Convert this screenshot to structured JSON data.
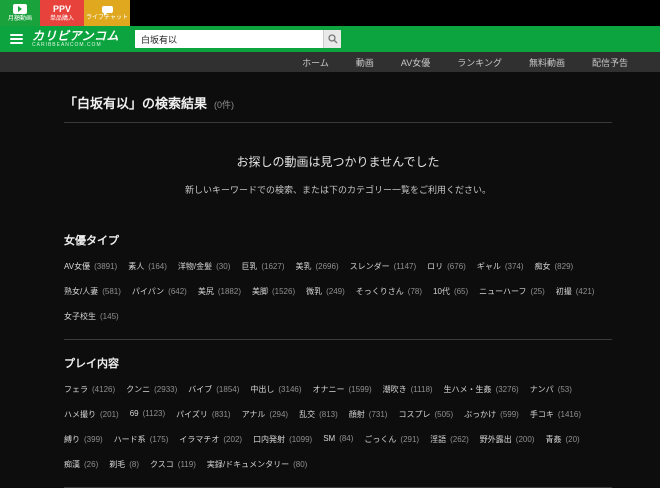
{
  "colors": {
    "brand_green": "#0ba43e",
    "monthly_green": "#1aa23c",
    "ppv_red": "#e8423c",
    "chat_yellow": "#dfa81e",
    "background": "#0d0d0d"
  },
  "promo_bar": {
    "monthly_button": {
      "label": "月額動画",
      "icon": "play-icon"
    },
    "ppv_button": {
      "title": "PPV",
      "label": "単品購入"
    },
    "chat_button": {
      "label": "ライブチャット",
      "icon": "chat-icon"
    }
  },
  "header": {
    "menu_icon": "hamburger-icon",
    "logo_title": "カリビアンコム",
    "logo_subtitle": "CARIBBEANCOM.COM",
    "search": {
      "value": "白坂有以",
      "icon": "search-icon"
    }
  },
  "nav": {
    "items": [
      "ホーム",
      "動画",
      "AV女優",
      "ランキング",
      "無料動画",
      "配信予告"
    ]
  },
  "main": {
    "title": "「白坂有以」の検索結果",
    "result_count": "(0件)",
    "empty_message": "お探しの動画は見つかりませんでした",
    "empty_hint": "新しいキーワードでの検索、または下のカテゴリー一覧をご利用ください。"
  },
  "categories": [
    {
      "heading": "女優タイプ",
      "tags": [
        {
          "label": "AV女優",
          "count": 3891
        },
        {
          "label": "素人",
          "count": 164
        },
        {
          "label": "洋物/金髪",
          "count": 30
        },
        {
          "label": "巨乳",
          "count": 1627
        },
        {
          "label": "美乳",
          "count": 2696
        },
        {
          "label": "スレンダー",
          "count": 1147
        },
        {
          "label": "ロリ",
          "count": 676
        },
        {
          "label": "ギャル",
          "count": 374
        },
        {
          "label": "痴女",
          "count": 829
        },
        {
          "label": "熟女/人妻",
          "count": 581
        },
        {
          "label": "パイパン",
          "count": 642
        },
        {
          "label": "美尻",
          "count": 1882
        },
        {
          "label": "美脚",
          "count": 1526
        },
        {
          "label": "微乳",
          "count": 249
        },
        {
          "label": "そっくりさん",
          "count": 78
        },
        {
          "label": "10代",
          "count": 65
        },
        {
          "label": "ニューハーフ",
          "count": 25
        },
        {
          "label": "初撮",
          "count": 421
        },
        {
          "label": "女子校生",
          "count": 145
        }
      ]
    },
    {
      "heading": "プレイ内容",
      "tags": [
        {
          "label": "フェラ",
          "count": 4126
        },
        {
          "label": "クンニ",
          "count": 2933
        },
        {
          "label": "バイブ",
          "count": 1854
        },
        {
          "label": "中出し",
          "count": 3146
        },
        {
          "label": "オナニー",
          "count": 1599
        },
        {
          "label": "潮吹き",
          "count": 1118
        },
        {
          "label": "生ハメ・生姦",
          "count": 3276
        },
        {
          "label": "ナンパ",
          "count": 53
        },
        {
          "label": "ハメ撮り",
          "count": 201
        },
        {
          "label": "69",
          "count": 1123
        },
        {
          "label": "パイズリ",
          "count": 831
        },
        {
          "label": "アナル",
          "count": 294
        },
        {
          "label": "乱交",
          "count": 813
        },
        {
          "label": "顔射",
          "count": 731
        },
        {
          "label": "コスプレ",
          "count": 505
        },
        {
          "label": "ぶっかけ",
          "count": 599
        },
        {
          "label": "手コキ",
          "count": 1416
        },
        {
          "label": "縛り",
          "count": 399
        },
        {
          "label": "ハード系",
          "count": 175
        },
        {
          "label": "イラマチオ",
          "count": 202
        },
        {
          "label": "口内発射",
          "count": 1099
        },
        {
          "label": "SM",
          "count": 84
        },
        {
          "label": "ごっくん",
          "count": 291
        },
        {
          "label": "淫語",
          "count": 262
        },
        {
          "label": "野外露出",
          "count": 200
        },
        {
          "label": "青姦",
          "count": 20
        },
        {
          "label": "痴漢",
          "count": 26
        },
        {
          "label": "剃毛",
          "count": 8
        },
        {
          "label": "クスコ",
          "count": 119
        },
        {
          "label": "実録/ドキュメンタリー",
          "count": 80
        }
      ]
    }
  ]
}
